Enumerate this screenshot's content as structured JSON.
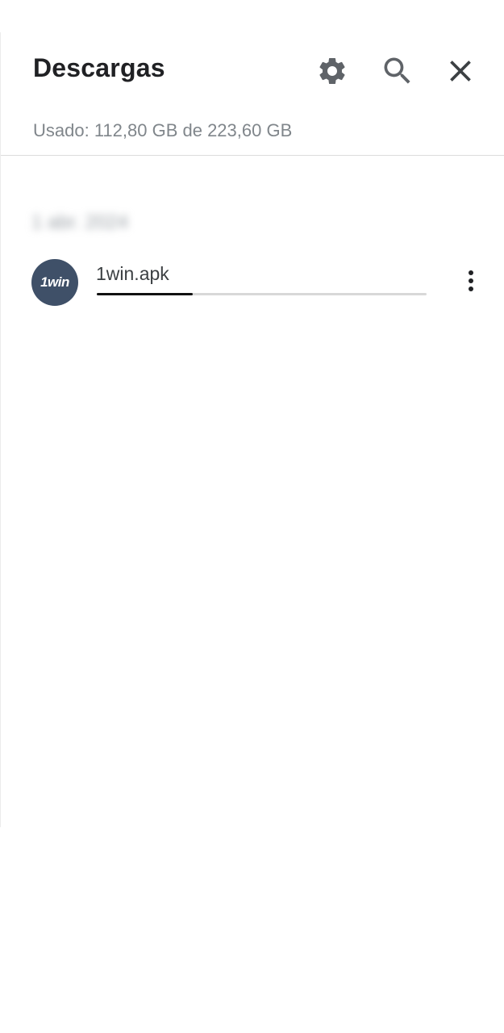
{
  "header": {
    "title": "Descargas",
    "icons": {
      "settings": "gear-icon",
      "search": "search-icon",
      "close": "close-icon"
    }
  },
  "storage": {
    "usage_text": "Usado: 112,80 GB de 223,60 GB"
  },
  "downloads": {
    "group_label": "1 abr. 2024",
    "items": [
      {
        "icon_text": "1win",
        "icon_color": "#3f5068",
        "file_name": "1win.apk",
        "progress": 0.29,
        "menu_icon": "more-vertical-icon"
      }
    ]
  },
  "colors": {
    "progress_fill": "#111111",
    "progress_track": "#d8d8d8"
  }
}
